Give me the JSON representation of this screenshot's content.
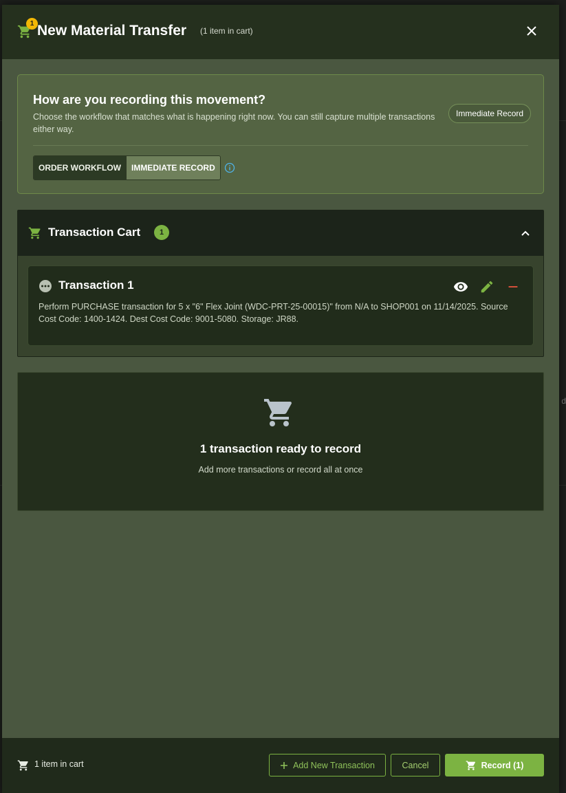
{
  "header": {
    "badge_count": "1",
    "title": "New Material Transfer",
    "subtitle": "(1 item in cart)",
    "close_icon": "close-icon"
  },
  "workflow": {
    "title": "How are you recording this movement?",
    "description": "Choose the workflow that matches what is happening right now. You can still capture multiple transactions either way.",
    "mode_chip": "Immediate Record",
    "options": [
      "ORDER WORKFLOW",
      "IMMEDIATE RECORD"
    ],
    "selected": "IMMEDIATE RECORD",
    "info_icon": "info-icon"
  },
  "cart": {
    "title": "Transaction Cart",
    "count": "1",
    "transactions": [
      {
        "title": "Transaction 1",
        "description": "Perform PURCHASE transaction for 5 x \"6\" Flex Joint (WDC-PRT-25-00015)\" from N/A to SHOP001 on 11/14/2025. Source Cost Code: 1400-1424. Dest Cost Code: 9001-5080. Storage: JR88."
      }
    ]
  },
  "ready": {
    "title": "1 transaction ready to record",
    "subtitle": "Add more transactions or record all at once"
  },
  "footer": {
    "cart_count": "1 item in cart",
    "add_label": "Add New Transaction",
    "cancel_label": "Cancel",
    "record_label": "Record (1)"
  },
  "colors": {
    "accent": "#7cb342",
    "badge": "#f2b705",
    "danger": "#e5533d",
    "info": "#4fb3e8"
  }
}
